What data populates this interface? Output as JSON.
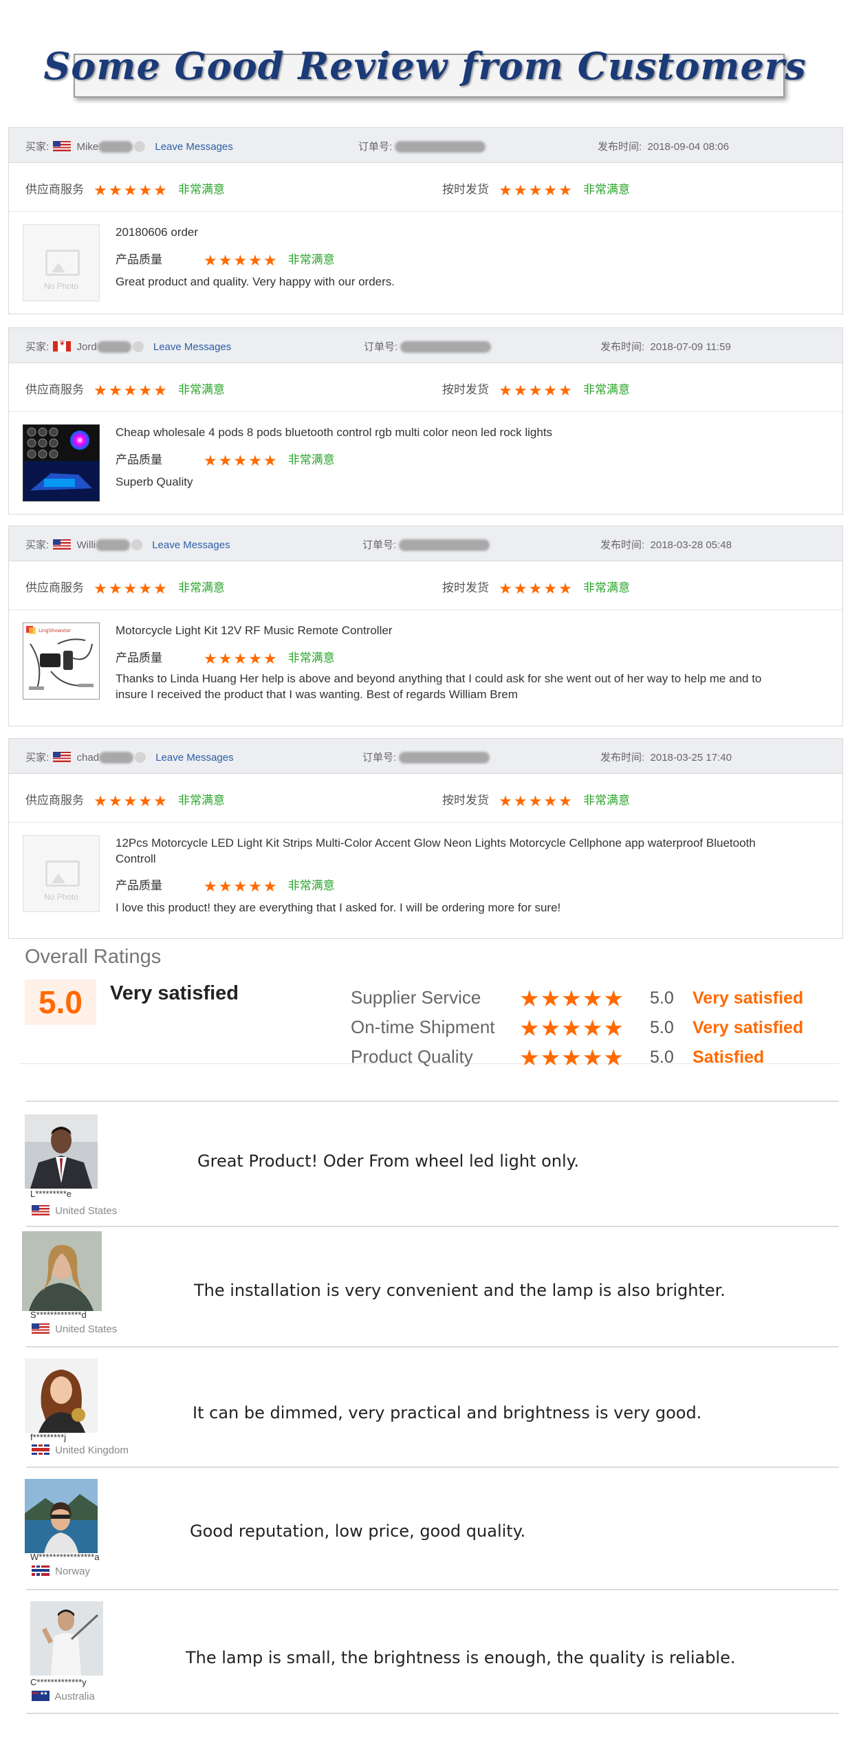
{
  "banner": {
    "title": "Some Good Review from Customers"
  },
  "labels": {
    "buyer": "买家:",
    "order_no": "订单号:",
    "posted_time": "发布时间:",
    "supplier_service": "供应商服务",
    "on_time_shipment": "按时发货",
    "product_quality": "产品质量",
    "very_satisfied_cn": "非常满意",
    "leave_messages": "Leave Messages",
    "stars": "★★★★★",
    "no_photo": "No Photo"
  },
  "reviews": [
    {
      "buyer": "Mike",
      "country": "us",
      "time": "2018-09-04 08:06",
      "product": "20180606 order",
      "comment": "Great product and quality. Very happy with our orders.",
      "thumb": "no-photo"
    },
    {
      "buyer": "Jord",
      "country": "ca",
      "time": "2018-07-09 11:59",
      "product": "Cheap wholesale 4 pods 8 pods bluetooth control rgb multi color neon led rock lights",
      "comment": "Superb Quality",
      "thumb": "rock-lights-photo"
    },
    {
      "buyer": "Willi",
      "country": "us",
      "time": "2018-03-28 05:48",
      "product": "Motorcycle Light Kit 12V RF Music Remote Controller",
      "comment": "Thanks to Linda Huang Her help is above and beyond anything that I could ask for she went out of her way to help me and to insure I received the product that I was wanting. Best of regards William Brem",
      "thumb": "motorcycle-kit-photo"
    },
    {
      "buyer": "chad",
      "country": "us",
      "time": "2018-03-25 17:40",
      "product": "12Pcs Motorcycle LED Light Kit Strips Multi-Color Accent Glow Neon Lights Motorcycle Cellphone app waterproof Bluetooth Controll",
      "comment": "I love this product! they are everything that I asked for. I will be ordering more for sure!",
      "thumb": "no-photo"
    }
  ],
  "overall": {
    "title": "Overall Ratings",
    "score": "5.0",
    "summary": "Very satisfied",
    "rows": [
      {
        "label": "Supplier Service",
        "score": "5.0",
        "text": "Very satisfied",
        "stars": "★★★★★"
      },
      {
        "label": "On-time Shipment",
        "score": "5.0",
        "text": "Very satisfied",
        "stars": "★★★★★"
      },
      {
        "label": "Product Quality",
        "score": "5.0",
        "text": "Satisfied",
        "stars": "★★★★★"
      }
    ]
  },
  "testimonials": [
    {
      "name": "L*********e",
      "country": "United States",
      "flag": "us",
      "quote": "Great Product! Oder From wheel led light only."
    },
    {
      "name": "S*************d",
      "country": "United States",
      "flag": "us",
      "quote": "The installation is very convenient and the lamp is also brighter."
    },
    {
      "name": "f*********j",
      "country": "United Kingdom",
      "flag": "gb",
      "quote": "It can be dimmed, very practical and brightness is very good."
    },
    {
      "name": "W****************a",
      "country": "Norway",
      "flag": "no",
      "quote": "Good reputation, low price, good quality."
    },
    {
      "name": "C*************y",
      "country": "Australia",
      "flag": "au",
      "quote": "The lamp is small, the brightness is enough, the quality is reliable."
    }
  ]
}
